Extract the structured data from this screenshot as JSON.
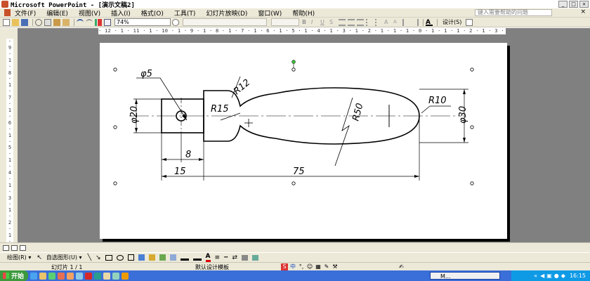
{
  "window": {
    "title": "Microsoft PowerPoint - [演示文稿2]"
  },
  "menu": {
    "items": [
      "文件(F)",
      "编辑(E)",
      "视图(V)",
      "插入(I)",
      "格式(O)",
      "工具(T)",
      "幻灯片放映(D)",
      "窗口(W)",
      "帮助(H)"
    ],
    "help_placeholder": "键入需要帮助的问题"
  },
  "toolbar": {
    "zoom": "74%",
    "design_label": "设计(S)"
  },
  "rulers": {
    "horizontal": "· 12 · 1 · 11 · 1 · 10 · 1 · 9 · 1 · 8 · 1 · 7 · 1 · 6 · 1 · 5 · 1 · 4 · 1 · 3 · 1 · 2 · 1 · 1 · 1 · 0 · 1 · 1 · 1 · 2 · 1 · 3 · 1 · 4 · 1 · 5 · 1 · 6 · 1 · 7 · 1 · 8 · 1 · 9 · 1 · 10 · 1 · 11 · 1 · 12 ·",
    "vertical": "· 9 · 1 · 8 · 1 · 7 · 1 · 6 · 1 · 5 · 1 · 4 · 1 · 3 · 1 · 2 · 1 · 1 · 1 · 0 · 1 · 1 · 1 · 2 · 1 · 3 · 1 · 4 · 1 · 5 · 1 · 6 · 1 · 7 · 1 · 8 · 1 · 9 ·"
  },
  "drawing": {
    "labels": {
      "phi5": "φ5",
      "r12": "R12",
      "r15": "R15",
      "r50": "R50",
      "r10": "R10",
      "phi20": "φ20",
      "phi30": "φ30",
      "dim8": "8",
      "dim15": "15",
      "dim75": "75"
    }
  },
  "drawbar": {
    "draw_label": "绘图(R) ▾",
    "autoshapes_label": "自选图形(U) ▾"
  },
  "status": {
    "slide": "幻灯片 1 / 1",
    "template": "默认设计模板",
    "ime_zh": "中"
  },
  "taskbar": {
    "start": "开始",
    "task": "M...",
    "time": "16:15"
  }
}
